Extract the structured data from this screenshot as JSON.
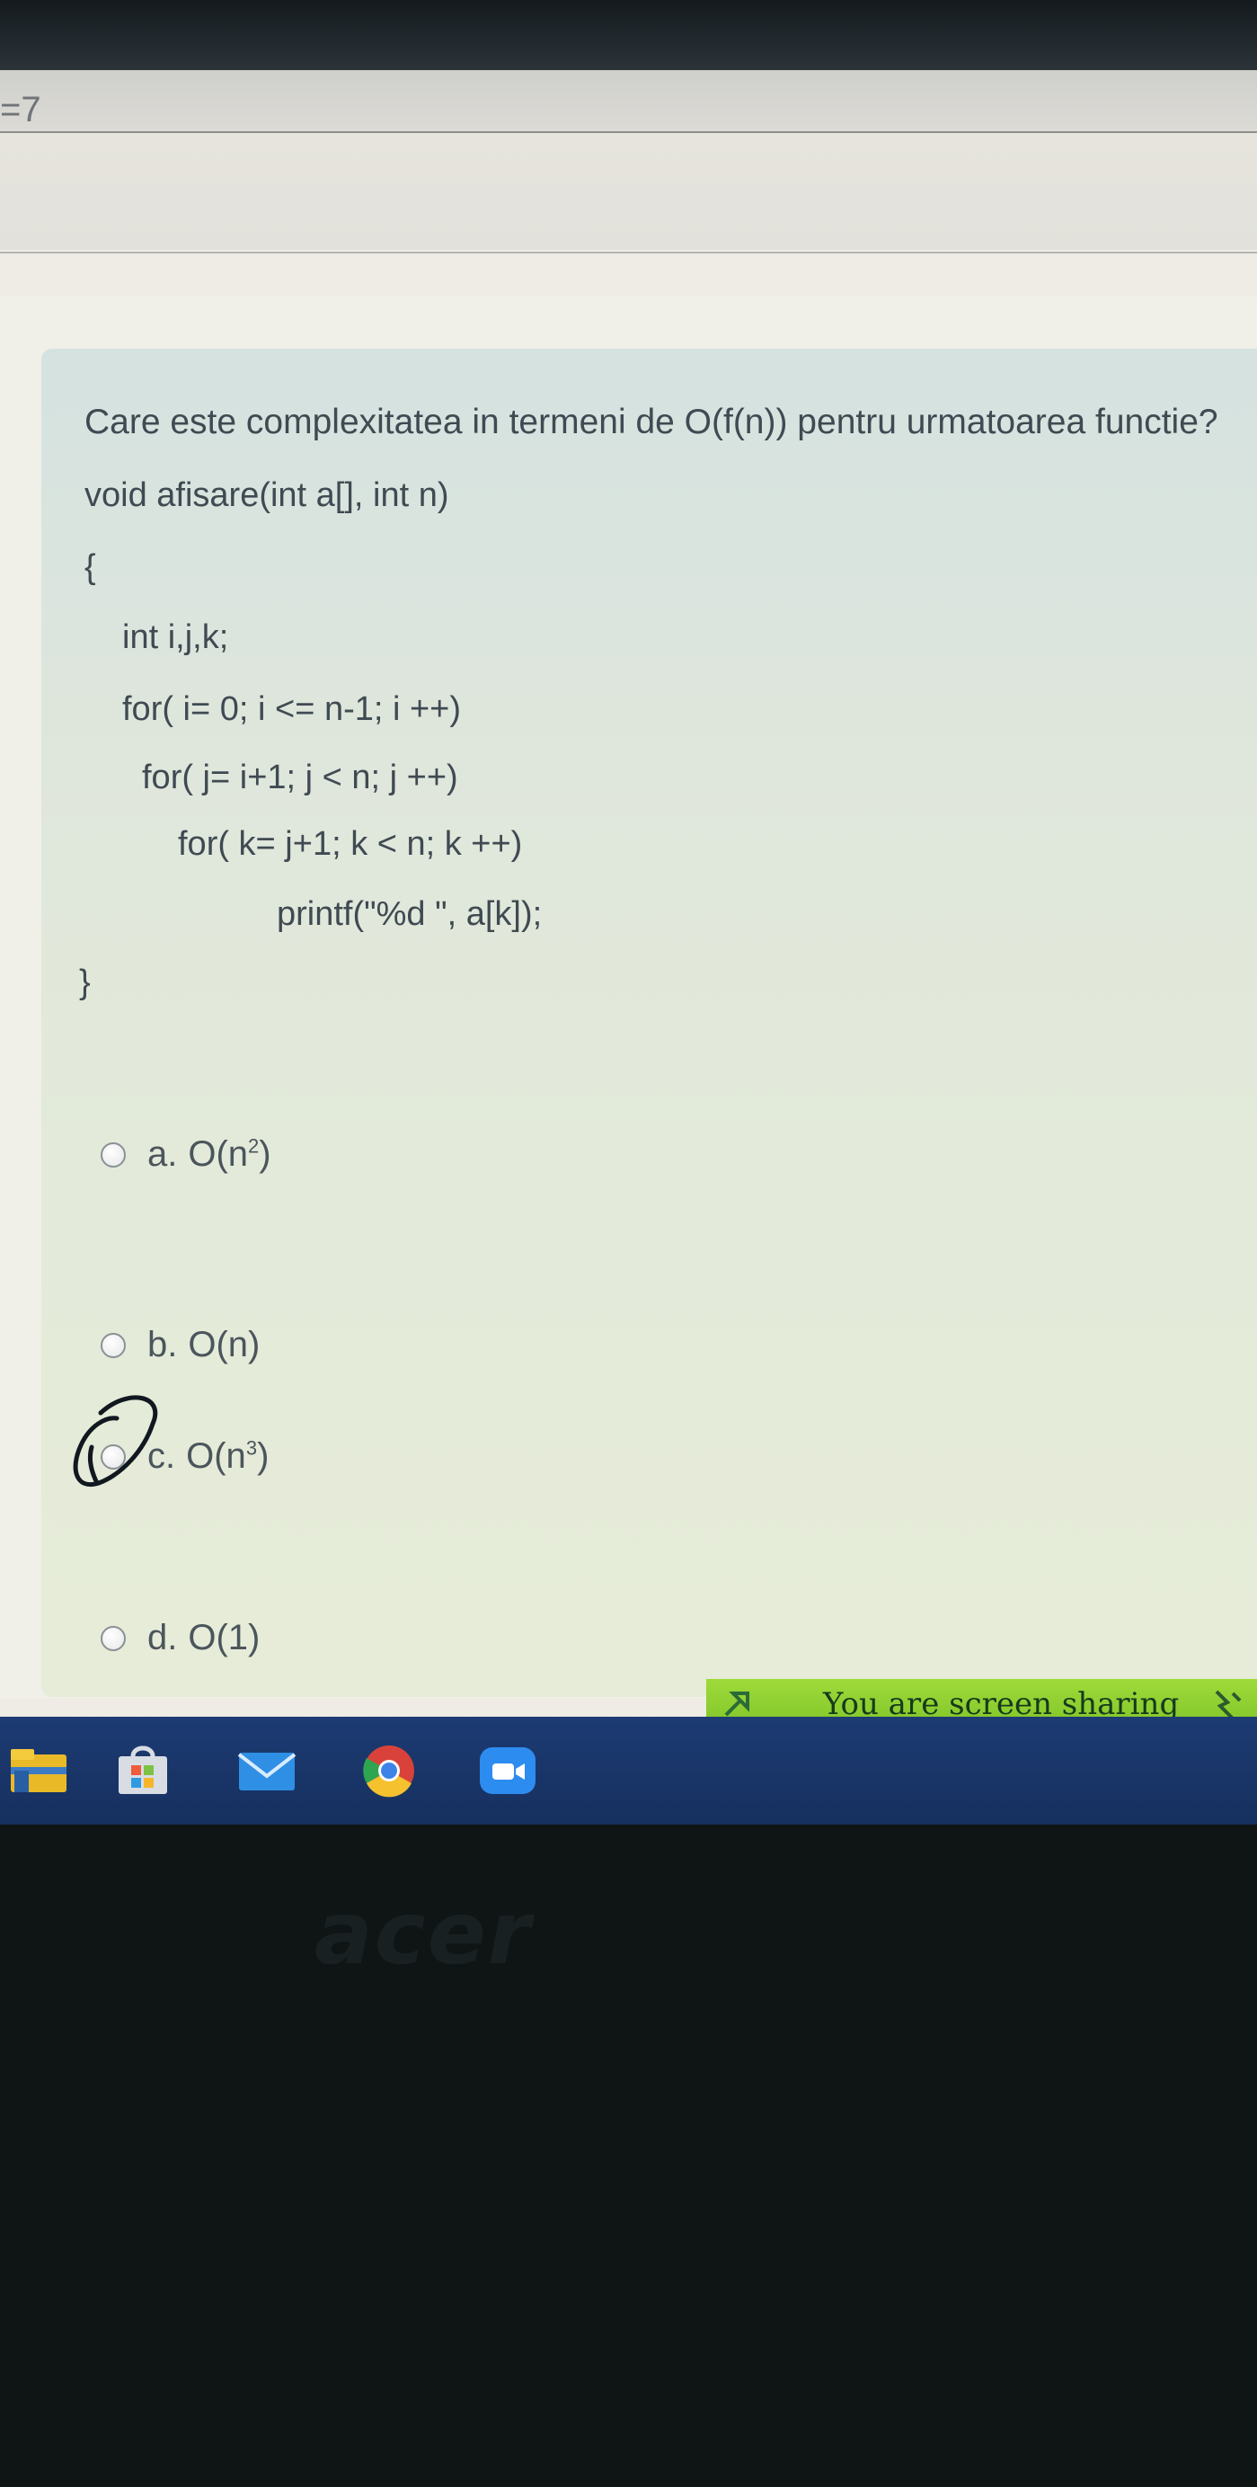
{
  "header": {
    "prev_fragment": "=7"
  },
  "question": {
    "prompt": "Care este complexitatea in termeni de O(f(n)) pentru urmatoarea functie?",
    "code": [
      "void afisare(int a[], int n)",
      "{",
      "int i,j,k;",
      "for( i= 0; i <= n-1; i ++)",
      "for( j= i+1; j < n; j ++)",
      "for( k= j+1; k < n; k ++)",
      "printf(\"%d \", a[k]);",
      "}"
    ]
  },
  "options": [
    {
      "letter": "a.",
      "base": "O(n",
      "exp": "2",
      "end": ")"
    },
    {
      "letter": "b.",
      "base": "O(n)",
      "exp": "",
      "end": ""
    },
    {
      "letter": "c.",
      "base": "O(n",
      "exp": "3",
      "end": ")"
    },
    {
      "letter": "d.",
      "base": "O(1)",
      "exp": "",
      "end": ""
    }
  ],
  "share_bar": {
    "text": "You are screen sharing",
    "color": "#8ccf2f"
  },
  "taskbar": {
    "apps": [
      "file-explorer-icon",
      "store-icon",
      "mail-icon",
      "chrome-icon",
      "zoom-icon"
    ]
  },
  "bezel": {
    "brand": "acer"
  },
  "colors": {
    "accent": "#1d3b74",
    "card": "#dde6dc",
    "text": "#3f4a52"
  }
}
